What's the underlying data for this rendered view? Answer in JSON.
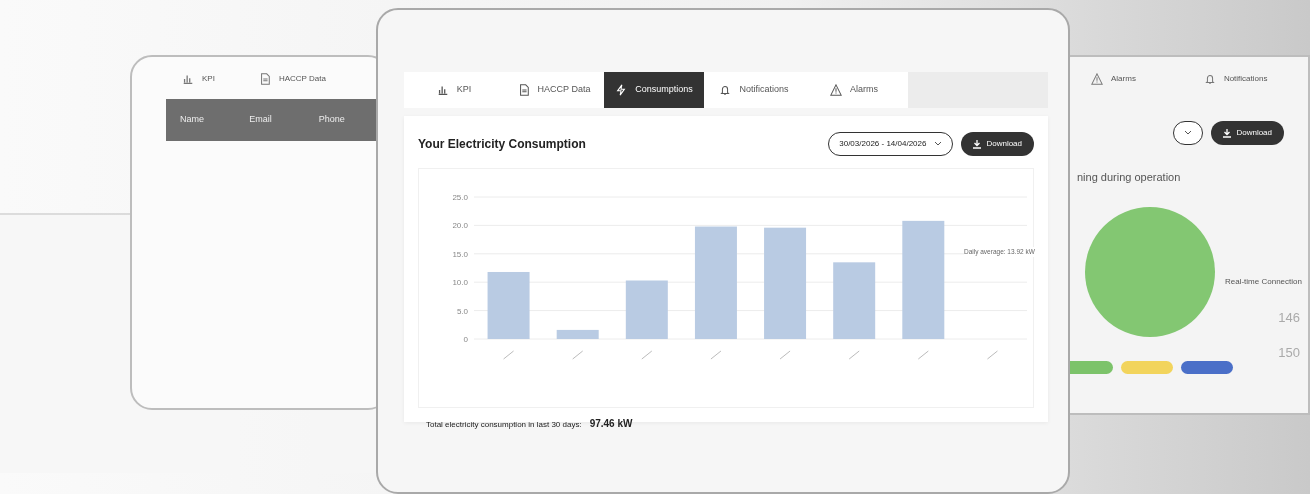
{
  "left_window": {
    "tabs": [
      {
        "label": "KPI"
      },
      {
        "label": "HACCP Data"
      }
    ],
    "table": {
      "columns": [
        "Name",
        "Email",
        "Phone"
      ]
    }
  },
  "main_window": {
    "tabs": [
      {
        "label": "KPI",
        "selected": false
      },
      {
        "label": "HACCP Data",
        "selected": false
      },
      {
        "label": "Consumptions",
        "selected": true
      },
      {
        "label": "Notifications",
        "selected": false
      },
      {
        "label": "Alarms",
        "selected": false
      }
    ],
    "card": {
      "title": "Your Electricity Consumption",
      "date_range": "30/03/2026 - 14/04/2026",
      "download": "Download",
      "chart_data": {
        "type": "bar",
        "grid": true,
        "ylim": [
          0,
          25
        ],
        "yticks": [
          0,
          {
            "value": 5,
            "label": "5.0"
          },
          {
            "value": 10,
            "label": "10.0"
          },
          {
            "value": 15,
            "label": "15.0"
          },
          {
            "value": 20,
            "label": "20.0"
          },
          {
            "value": 25,
            "label": "25.0"
          }
        ],
        "values": [
          11.8,
          1.6,
          10.3,
          19.8,
          19.6,
          13.5,
          20.8,
          null
        ]
      },
      "average_label": "Daily average: 13.92 kW",
      "total_label": "Total electricity consumption in last 30 days:",
      "total_value": "97.46 kW"
    }
  },
  "right_window": {
    "tabs": [
      {
        "label": "Alarms"
      },
      {
        "label": "Notifications"
      }
    ],
    "download": "Download",
    "heading": "ning during operation",
    "subheading": "Real-time Connection",
    "values": [
      "146",
      "150"
    ],
    "legend": [
      {
        "color": "#7cc36a"
      },
      {
        "color": "#f2d45c"
      },
      {
        "color": "#4a6fc8"
      }
    ]
  }
}
